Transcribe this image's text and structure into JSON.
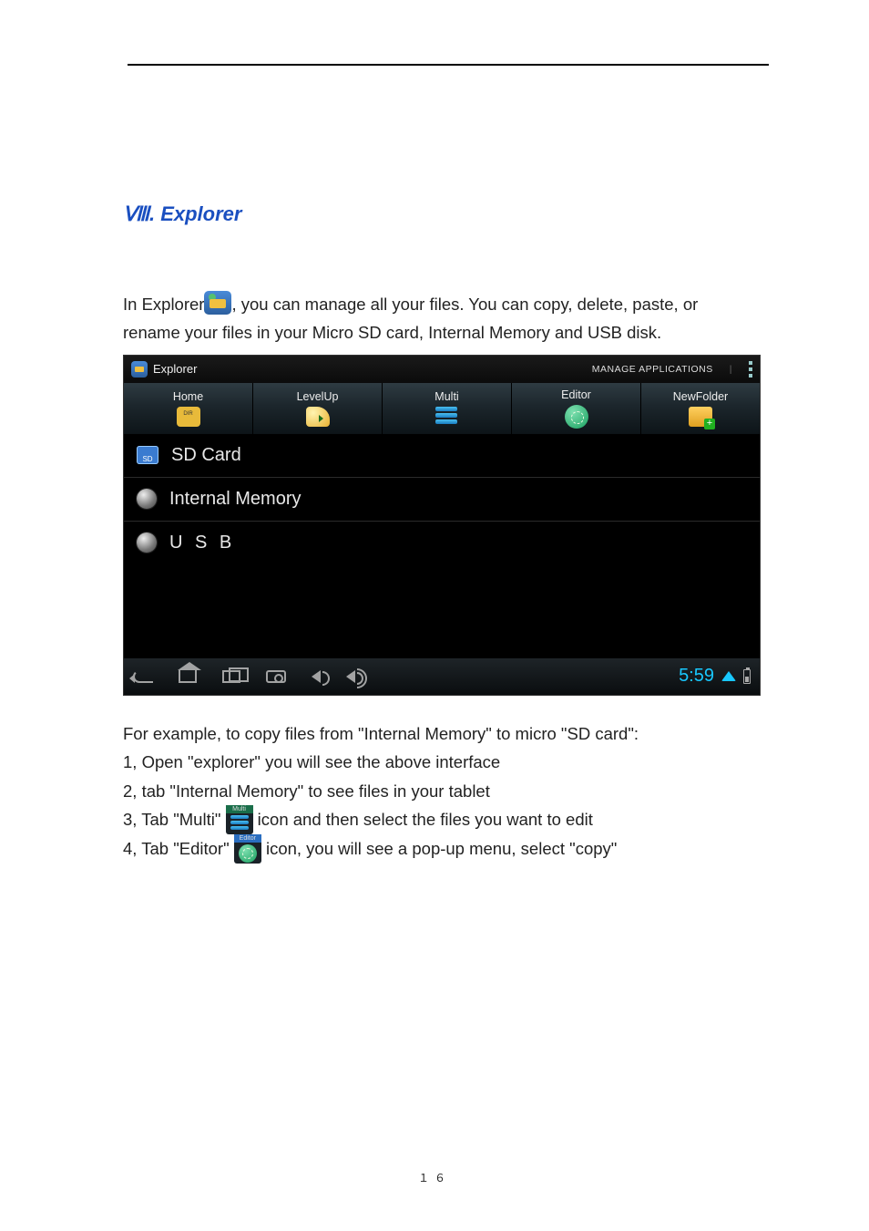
{
  "document": {
    "heading_prefix": "Ⅷ",
    "heading": ". Explorer",
    "intro_before": "In Explorer",
    "intro_after": ", you can manage all your files. You can copy, delete, paste, or rename your files in your Micro SD card, Internal Memory and USB disk.",
    "example_intro": "For example, to copy files from \"Internal Memory\" to micro \"SD card\":",
    "steps": {
      "s1": "1, Open \"explorer\" you will see the above interface",
      "s2": "2, tab \"Internal Memory\" to see files in your tablet",
      "s3a": "3, Tab \"Multi\" ",
      "s3b": " icon and then select the files you want to edit",
      "s4a": "4, Tab \"Editor\" ",
      "s4b": " icon, you will see a pop-up menu, select \"copy\""
    },
    "mini_labels": {
      "multi": "Multi",
      "editor": "Editor"
    },
    "page_number": "１６"
  },
  "screenshot": {
    "title": "Explorer",
    "manage": "MANAGE APPLICATIONS",
    "tabs": {
      "home": "Home",
      "level": "LevelUp",
      "multi": "Multi",
      "editor": "Editor",
      "newf": "NewFolder"
    },
    "list": {
      "sd": "SD Card",
      "internal": "Internal Memory",
      "usb": "U S B"
    },
    "clock": "5:59"
  }
}
